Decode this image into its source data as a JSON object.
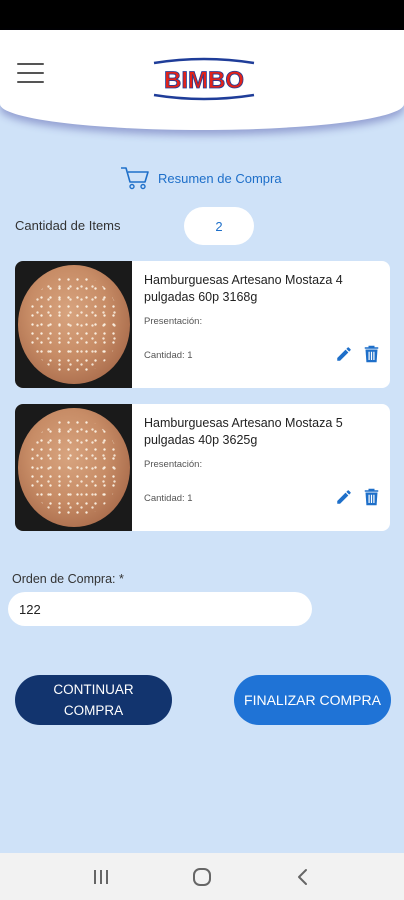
{
  "header": {
    "logo_text": "BIMBO",
    "menu_icon": "hamburger-menu-icon"
  },
  "summary": {
    "title": "Resumen de Compra",
    "icon": "cart-icon"
  },
  "items_count": {
    "label": "Cantidad de Items",
    "value": "2"
  },
  "products": [
    {
      "name": "Hamburguesas Artesano Mostaza 4 pulgadas 60p 3168g",
      "presentation_label": "Presentación:",
      "quantity_label": "Cantidad: 1"
    },
    {
      "name": "Hamburguesas Artesano Mostaza 5 pulgadas 40p 3625g",
      "presentation_label": "Presentación:",
      "quantity_label": "Cantidad: 1"
    }
  ],
  "purchase_order": {
    "label": "Orden de Compra: *",
    "value": "122"
  },
  "buttons": {
    "continue": "CONTINUAR COMPRA",
    "finish": "FINALIZAR COMPRA"
  },
  "colors": {
    "background": "#cfe2f8",
    "accent_blue": "#1e6fc9",
    "dark_navy": "#12346e",
    "bright_blue": "#1f73d6",
    "logo_red": "#e2231a",
    "logo_blue": "#1f3d99"
  }
}
